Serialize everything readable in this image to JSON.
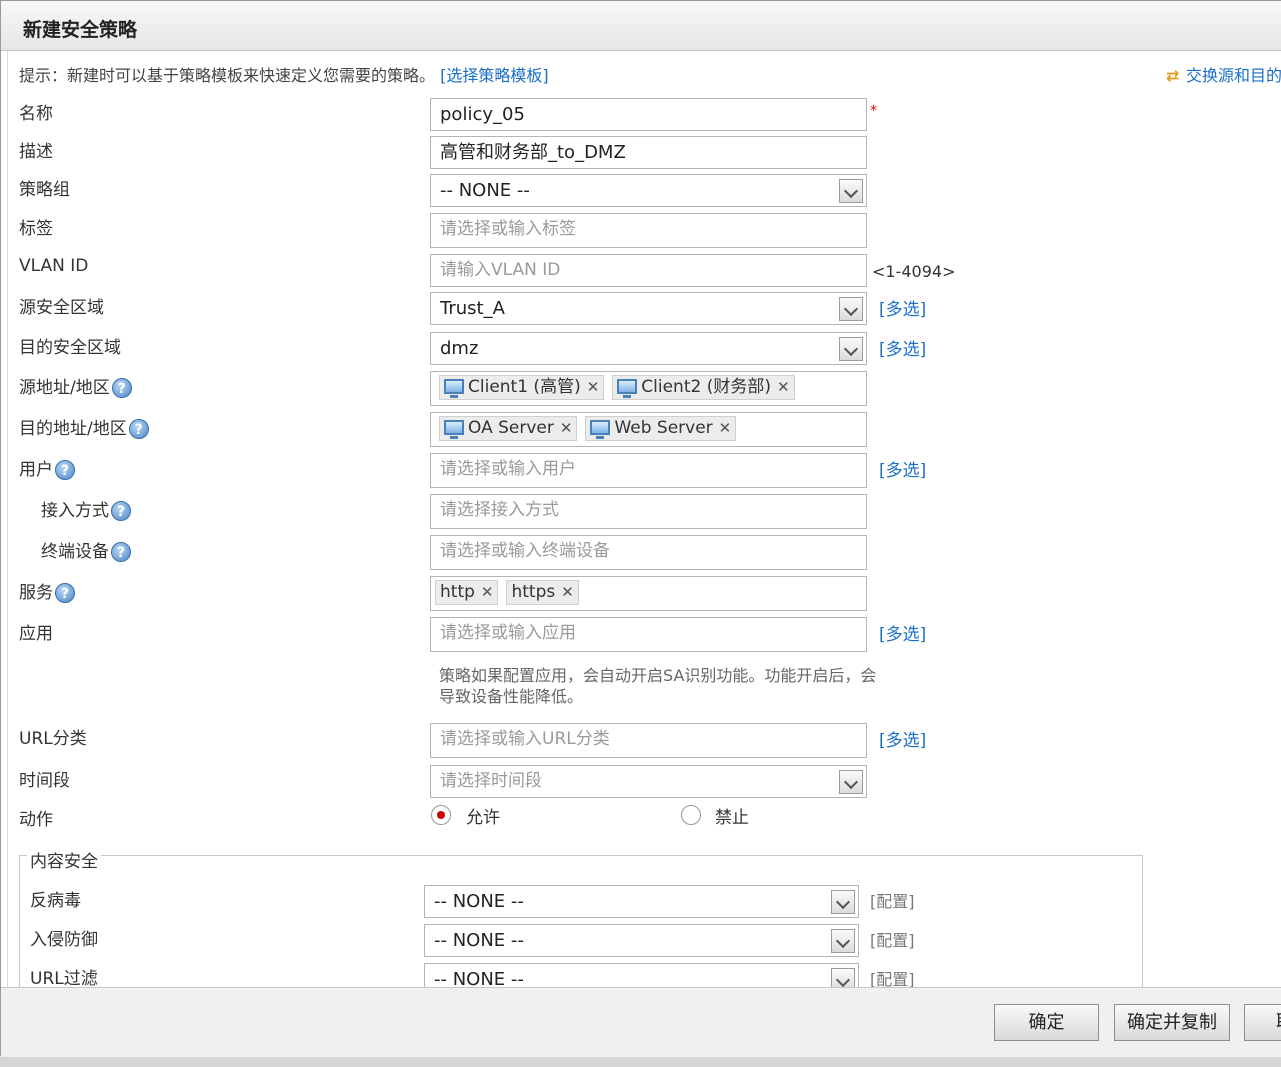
{
  "dialog": {
    "title": "新建安全策略",
    "hint_text": "提示：新建时可以基于策略模板来快速定义您需要的策略。",
    "hint_link": "[选择策略模板]",
    "swap_link": "交换源和目的"
  },
  "form": {
    "name_label": "名称",
    "name_value": "policy_05",
    "required_mark": "*",
    "desc_label": "描述",
    "desc_value": "高管和财务部_to_DMZ",
    "group_label": "策略组",
    "group_value": "-- NONE --",
    "tag_label": "标签",
    "tag_placeholder": "请选择或输入标签",
    "vlan_label": "VLAN ID",
    "vlan_placeholder": "请输入VLAN ID",
    "vlan_range": "<1-4094>",
    "src_zone_label": "源安全区域",
    "src_zone_value": "Trust_A",
    "dst_zone_label": "目的安全区域",
    "dst_zone_value": "dmz",
    "multi_label": "[多选]",
    "src_addr_label": "源地址/地区",
    "src_addr_tags": [
      "Client1 (高管)",
      "Client2 (财务部)"
    ],
    "dst_addr_label": "目的地址/地区",
    "dst_addr_tags": [
      "OA Server",
      "Web Server"
    ],
    "user_label": "用户",
    "user_placeholder": "请选择或输入用户",
    "access_label": "接入方式",
    "access_placeholder": "请选择接入方式",
    "terminal_label": "终端设备",
    "terminal_placeholder": "请选择或输入终端设备",
    "service_label": "服务",
    "service_tags": [
      "http",
      "https"
    ],
    "app_label": "应用",
    "app_placeholder": "请选择或输入应用",
    "app_note": "策略如果配置应用，会自动开启SA识别功能。功能开启后，会导致设备性能降低。",
    "url_label": "URL分类",
    "url_placeholder": "请选择或输入URL分类",
    "time_label": "时间段",
    "time_placeholder": "请选择时间段",
    "action_label": "动作",
    "action_allow": "允许",
    "action_deny": "禁止",
    "action_selected": "允许",
    "help_glyph": "?",
    "tag_remove": "✕"
  },
  "content_security": {
    "legend": "内容安全",
    "config_label": "[配置]",
    "rows": [
      {
        "label": "反病毒",
        "value": "-- NONE --"
      },
      {
        "label": "入侵防御",
        "value": "-- NONE --"
      },
      {
        "label": "URL过滤",
        "value": "-- NONE --"
      }
    ]
  },
  "footer": {
    "ok_label": "确定",
    "ok_copy_label": "确定并复制",
    "cancel_label": "取消"
  },
  "icons": {
    "help": "help-icon",
    "swap": "swap-icon",
    "computer": "computer-icon",
    "remove": "remove-tag-icon",
    "dropdown": "chevron-down-icon"
  },
  "colors": {
    "link": "#1a6fc9",
    "required": "#dd0000",
    "radio_selected": "#cc0000"
  }
}
